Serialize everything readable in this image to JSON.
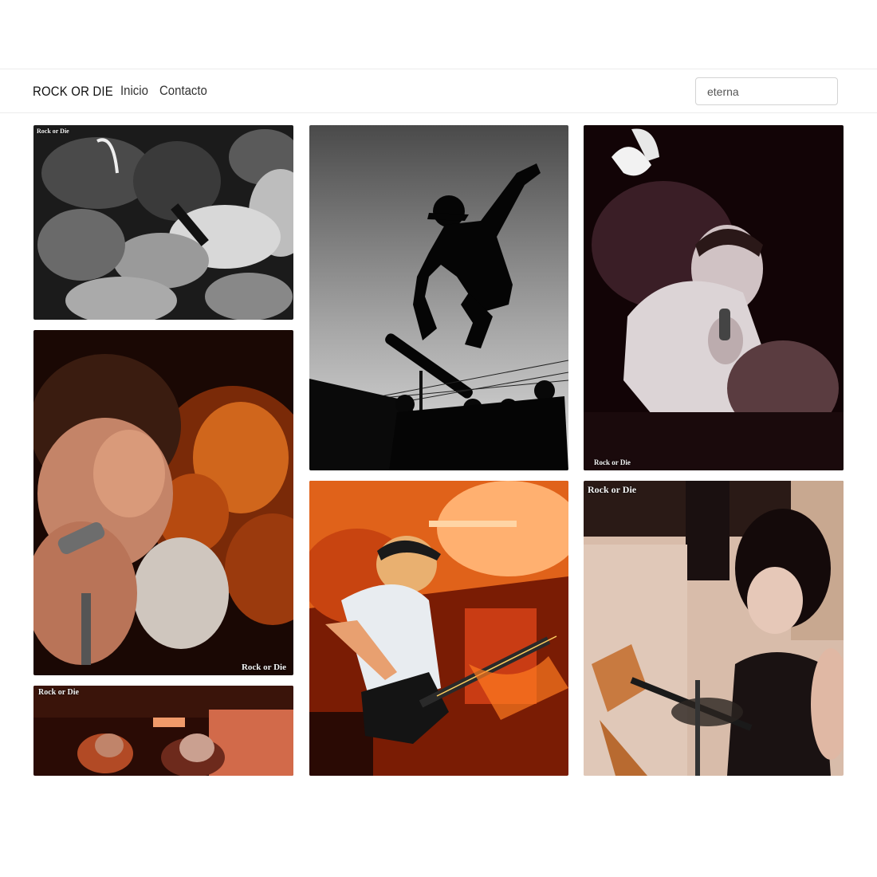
{
  "navbar": {
    "brand": "ROCK OR DIE",
    "links": [
      "Inicio",
      "Contacto"
    ],
    "search": {
      "value": "eterna",
      "placeholder": ""
    }
  },
  "gallery": {
    "watermark": "Rock or Die",
    "photos": [
      {
        "icon": "crowd-singing-photo",
        "tone": "black-and-white"
      },
      {
        "icon": "skateboard-jump-photo",
        "tone": "black-and-white"
      },
      {
        "icon": "singer-screaming-photo",
        "tone": "dark"
      },
      {
        "icon": "singer-with-microphone-photo",
        "tone": "orange"
      },
      {
        "icon": "bassist-playing-photo",
        "tone": "orange"
      },
      {
        "icon": "female-guitarist-photo",
        "tone": "sepia"
      },
      {
        "icon": "band-on-stage-photo",
        "tone": "red"
      }
    ]
  }
}
